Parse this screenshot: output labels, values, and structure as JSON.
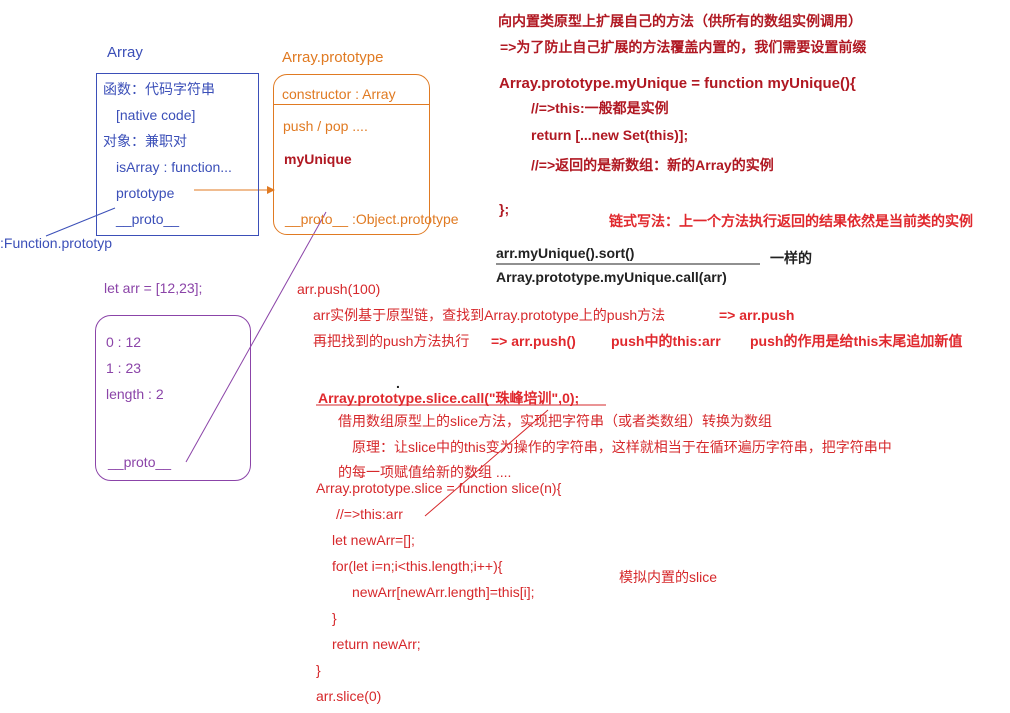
{
  "array_box": {
    "title": "Array",
    "items": [
      "函数：代码字符串",
      "[native code]",
      "对象：兼职对",
      "isArray : function...",
      "prototype",
      "__proto__"
    ],
    "proto_label": ":Function.prototyp"
  },
  "proto_box": {
    "title": "Array.prototype",
    "constructor": "constructor : Array",
    "push_pop": "push / pop ....",
    "my_unique": "myUnique",
    "proto": "__proto__ :Object.prototype"
  },
  "arr_decl": "let arr = [12,23];",
  "arr_box": {
    "items": [
      "0 : 12",
      "1 : 23",
      "length : 2"
    ],
    "proto": "__proto__"
  },
  "right_top": {
    "line1": "向内置类原型上扩展自己的方法（供所有的数组实例调用）",
    "line2": "=>为了防止自己扩展的方法覆盖内置的，我们需要设置前缀",
    "code1": "Array.prototype.myUnique = function myUnique(){",
    "code2": "//=>this:一般都是实例",
    "code3": "return [...new Set(this)];",
    "code4": "//=>返回的是新数组：新的Array的实例",
    "code5": "};",
    "chain_note": "链式写法：上一个方法执行返回的结果依然是当前类的实例",
    "call1": "arr.myUnique().sort()",
    "call2": "Array.prototype.myUnique.call(arr)",
    "same": "一样的"
  },
  "push_section": {
    "line1": "arr.push(100)",
    "line2": "arr实例基于原型链，查找到Array.prototype上的push方法",
    "line2b": "=> arr.push",
    "line3": "再把找到的push方法执行",
    "line3b": "=> arr.push()",
    "line3c": "push中的this:arr",
    "line3d": "push的作用是给this末尾追加新值"
  },
  "slice_section": {
    "dot": ".",
    "call": "Array.prototype.slice.call(\"珠峰培训\",0);",
    "desc1": "借用数组原型上的slice方法，实现把字符串（或者类数组）转换为数组",
    "desc2": "原理：让slice中的this变为操作的字符串，这样就相当于在循环遍历字符串，把字符串中",
    "desc3": "的每一项赋值给新的数组 ....",
    "code": [
      "Array.prototype.slice  =  function slice(n){",
      "//=>this:arr",
      "let newArr=[];",
      "for(let i=n;i<this.length;i++){",
      "newArr[newArr.length]=this[i];",
      "}",
      "return newArr;",
      "}",
      "arr.slice(0)"
    ],
    "note": "模拟内置的slice"
  },
  "colors": {
    "blue": "#3b4fb8",
    "orange": "#e07a22",
    "purple": "#8b44a8",
    "red": "#d6282b",
    "dark_red": "#b01822"
  }
}
